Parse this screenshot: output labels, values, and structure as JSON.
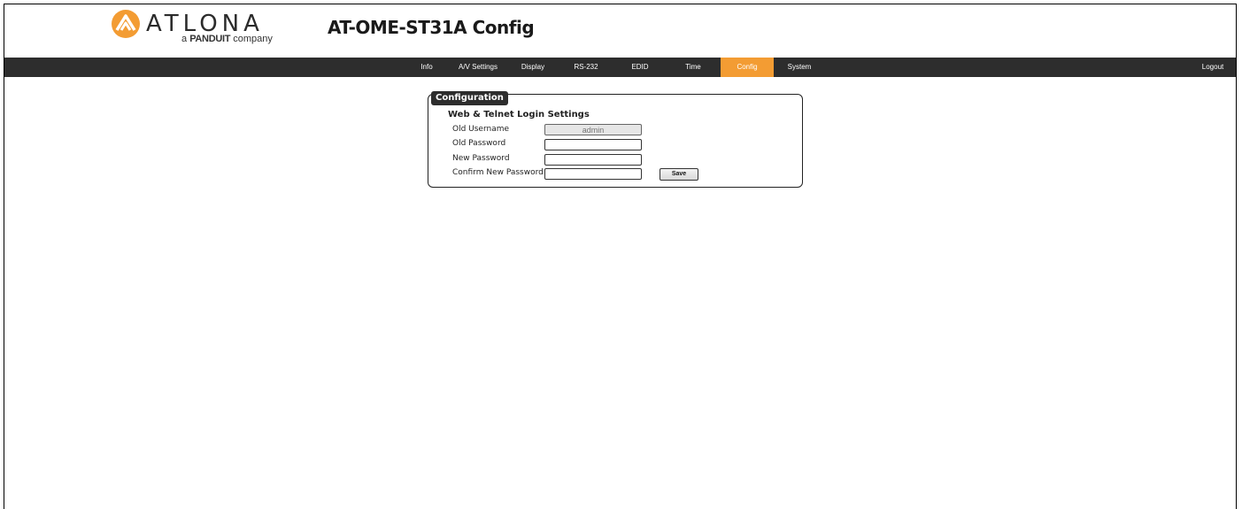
{
  "brand": {
    "name": "ATLONA",
    "tagline_prefix": "a",
    "tagline_brand": "PANDUIT",
    "tagline_suffix": "company",
    "accent": "#f39c33"
  },
  "header": {
    "title": "AT-OME-ST31A  Config"
  },
  "nav": {
    "items": [
      {
        "label": "Info"
      },
      {
        "label": "A/V Settings"
      },
      {
        "label": "Display"
      },
      {
        "label": "RS-232"
      },
      {
        "label": "EDID"
      },
      {
        "label": "Time"
      },
      {
        "label": "Config",
        "active": true
      },
      {
        "label": "System"
      }
    ],
    "logout": "Logout",
    "bar_color": "#2d2d2d"
  },
  "config": {
    "legend": "Configuration",
    "section_title": "Web & Telnet Login Settings",
    "fields": [
      {
        "label": "Old Username",
        "value": "admin",
        "disabled": true
      },
      {
        "label": "Old Password",
        "value": ""
      },
      {
        "label": "New Password",
        "value": ""
      },
      {
        "label": "Confirm New Password",
        "value": ""
      }
    ],
    "save_label": "Save"
  }
}
